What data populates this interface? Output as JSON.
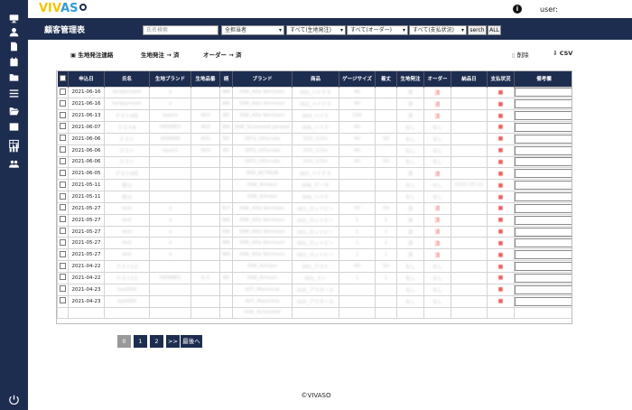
{
  "app": {
    "logo_part1": "VIV",
    "logo_part2": "AS",
    "logo_o": ""
  },
  "topbar": {
    "info": "i",
    "user_label": "user:"
  },
  "sidebar": {
    "icons": [
      "monitor-icon",
      "user-icon",
      "document-icon",
      "calendar-icon",
      "folder-icon",
      "list-icon",
      "folder-open-icon",
      "list-alt-icon",
      "table-icon",
      "bar-chart-icon",
      "users-icon",
      "power-icon"
    ]
  },
  "header": {
    "title": "顧客管理表",
    "search_placeholder": "氏名検索",
    "filter_staff": "全担当者",
    "filter_fabric_order": "すべて(生地発注)",
    "filter_order": "すべて(オーダー)",
    "filter_payment": "すべて(支払状況)",
    "search_button": "serch",
    "all_button": "ALL"
  },
  "actions": {
    "fabric_order_contact": "生地発注連絡",
    "fabric_order_done": "生地発注 → 済",
    "order_done": "オーダー → 済",
    "delete": "削除",
    "csv": "CSV"
  },
  "table": {
    "headers": [
      "",
      "申込日",
      "氏名",
      "生地ブランド",
      "生地品番",
      "柄",
      "ブランド",
      "商品",
      "ゲージサイズ",
      "着丈",
      "生地発注",
      "オーダー",
      "納品日",
      "支払状況",
      "備考欄"
    ],
    "rows": [
      {
        "date": "2021-06-16",
        "name": "fordasmash",
        "brand": "a",
        "code": "",
        "gara": "WA",
        "mbrand": "ISW_Alfa Vermoon",
        "product": "002_ハイテス",
        "gauge": "40",
        "length": "",
        "fabric": "済",
        "order": "済",
        "delivery": "",
        "pay": "■"
      },
      {
        "date": "2021-06-16",
        "name": "fordasmash",
        "brand": "a",
        "code": "",
        "gara": "WA",
        "mbrand": "ISW_Alfa Vermoon",
        "product": "002_ハイテス",
        "gauge": "40",
        "length": "",
        "fabric": "済",
        "order": "済",
        "delivery": "",
        "pay": "■"
      },
      {
        "date": "2021-06-13",
        "name": "テストA社",
        "brand": "layers",
        "code": "003",
        "gara": "B5",
        "mbrand": "ISW_Alfa Vermoon",
        "product": "004_ハイテ",
        "gauge": "100",
        "length": "",
        "fabric": "済",
        "order": "済",
        "delivery": "",
        "pay": "■"
      },
      {
        "date": "2021-06-07",
        "name": "テストB",
        "brand": "HERMES",
        "code": "403",
        "gara": "WA",
        "mbrand": "ISW_Scissored garbed",
        "product": "006_ハイテ",
        "gauge": "40",
        "length": "",
        "fabric": "なし",
        "order": "なし",
        "delivery": "",
        "pay": "■"
      },
      {
        "date": "2021-06-06",
        "name": "テスト",
        "brand": "ARMANI",
        "code": "403",
        "gara": "B5",
        "mbrand": "ISFG_Ulfuruda",
        "product": "010_1/2in",
        "gauge": "40",
        "length": "50",
        "fabric": "なし",
        "order": "なし",
        "delivery": "",
        "pay": "■"
      },
      {
        "date": "2021-06-06",
        "name": "テスト",
        "brand": "layers",
        "code": "403",
        "gara": "B5",
        "mbrand": "ISFG_Ulfuruda",
        "product": "010_1/2in",
        "gauge": "40",
        "length": "",
        "fabric": "なし",
        "order": "なし",
        "delivery": "",
        "pay": "■"
      },
      {
        "date": "2021-06-06",
        "name": "テスト",
        "brand": "",
        "code": "",
        "gara": "",
        "mbrand": "ISFG_Ulfuruda",
        "product": "010_1/2in",
        "gauge": "40",
        "length": "50",
        "fabric": "なし",
        "order": "なし",
        "delivery": "",
        "pay": "■"
      },
      {
        "date": "2021-06-05",
        "name": "テストA社",
        "brand": "",
        "code": "",
        "gara": "",
        "mbrand": "009_ACTRUR",
        "product": "007_ハイテス",
        "gauge": "",
        "length": "",
        "fabric": "済",
        "order": "済",
        "delivery": "",
        "pay": "■"
      },
      {
        "date": "2021-05-11",
        "name": "佐山",
        "brand": "",
        "code": "",
        "gara": "",
        "mbrand": "ISW_Armani",
        "product": "006_データ",
        "gauge": "",
        "length": "",
        "fabric": "なし",
        "order": "なし",
        "delivery": "2021-05-11",
        "pay": "■"
      },
      {
        "date": "2021-05-11",
        "name": "佐山",
        "brand": "",
        "code": "",
        "gara": "",
        "mbrand": "ISW_Armani",
        "product": "006_ハイテ",
        "gauge": "",
        "length": "",
        "fabric": "なし",
        "order": "なし",
        "delivery": "",
        "pay": "■"
      },
      {
        "date": "2021-05-27",
        "name": "test",
        "brand": "a",
        "code": "",
        "gara": "B-F",
        "mbrand": "ISW_Alfa Vermoon",
        "product": "001_ロットビー",
        "gauge": "50",
        "length": "50",
        "fabric": "済",
        "order": "済",
        "delivery": "",
        "pay": "■"
      },
      {
        "date": "2021-05-27",
        "name": "test",
        "brand": "a",
        "code": "",
        "gara": "WA",
        "mbrand": "ISW_Alfa Vermoon",
        "product": "001_ロットビー",
        "gauge": "1",
        "length": "1",
        "fabric": "済",
        "order": "済",
        "delivery": "",
        "pay": "■"
      },
      {
        "date": "2021-05-27",
        "name": "test",
        "brand": "a",
        "code": "",
        "gara": "WA",
        "mbrand": "ISW_Alfa Vermoon",
        "product": "001_ロットビー",
        "gauge": "1",
        "length": "1",
        "fabric": "済",
        "order": "済",
        "delivery": "",
        "pay": "■"
      },
      {
        "date": "2021-05-27",
        "name": "test",
        "brand": "a",
        "code": "",
        "gara": "WA",
        "mbrand": "ISW_Alfa Vermoon",
        "product": "001_ロットビー",
        "gauge": "1",
        "length": "1",
        "fabric": "済",
        "order": "済",
        "delivery": "",
        "pay": "■"
      },
      {
        "date": "2021-05-27",
        "name": "test",
        "brand": "a",
        "code": "",
        "gara": "WA",
        "mbrand": "ISW_Alfa Vermoon",
        "product": "001_ロットビー",
        "gauge": "1",
        "length": "1",
        "fabric": "済",
        "order": "済",
        "delivery": "",
        "pay": "■"
      },
      {
        "date": "2021-04-22",
        "name": "テストC2",
        "brand": "",
        "code": "",
        "gara": "",
        "mbrand": "ISW_Armani",
        "product": "001_テスト",
        "gauge": "40",
        "length": "50",
        "fabric": "なし",
        "order": "なし",
        "delivery": "",
        "pay": "■"
      },
      {
        "date": "2021-04-22",
        "name": "テストC2",
        "brand": "HERMES",
        "code": "6-3",
        "gara": "B5",
        "mbrand": "ISW_Armani",
        "product": "001_スト",
        "gauge": "1",
        "length": "1",
        "fabric": "なし",
        "order": "なし",
        "delivery": "",
        "pay": "■"
      },
      {
        "date": "2021-04-23",
        "name": "test000",
        "brand": "",
        "code": "",
        "gara": "",
        "mbrand": "007_Maxmine",
        "product": "020_アウタール",
        "gauge": "",
        "length": "",
        "fabric": "なし",
        "order": "なし",
        "delivery": "",
        "pay": "■"
      },
      {
        "date": "2021-04-23",
        "name": "test000",
        "brand": "",
        "code": "",
        "gara": "",
        "mbrand": "007_Maxmine",
        "product": "020_アウタール",
        "gauge": "",
        "length": "",
        "fabric": "なし",
        "order": "なし",
        "delivery": "",
        "pay": "■"
      },
      {
        "date": "",
        "name": "",
        "brand": "",
        "code": "",
        "gara": "",
        "mbrand": "ISW_Scissored",
        "product": "",
        "gauge": "",
        "length": "",
        "fabric": "",
        "order": "",
        "delivery": "",
        "pay": ""
      }
    ]
  },
  "pagination": {
    "pages": [
      "0",
      "1",
      "2"
    ],
    "next": ">>",
    "last": "最後へ"
  },
  "footer": {
    "copyright": "©VIVASO"
  },
  "colors": {
    "navy": "#1d2d50",
    "logo_yellow": "#f3c400",
    "logo_blue": "#2f9bd6",
    "status_red": "#e86060"
  }
}
